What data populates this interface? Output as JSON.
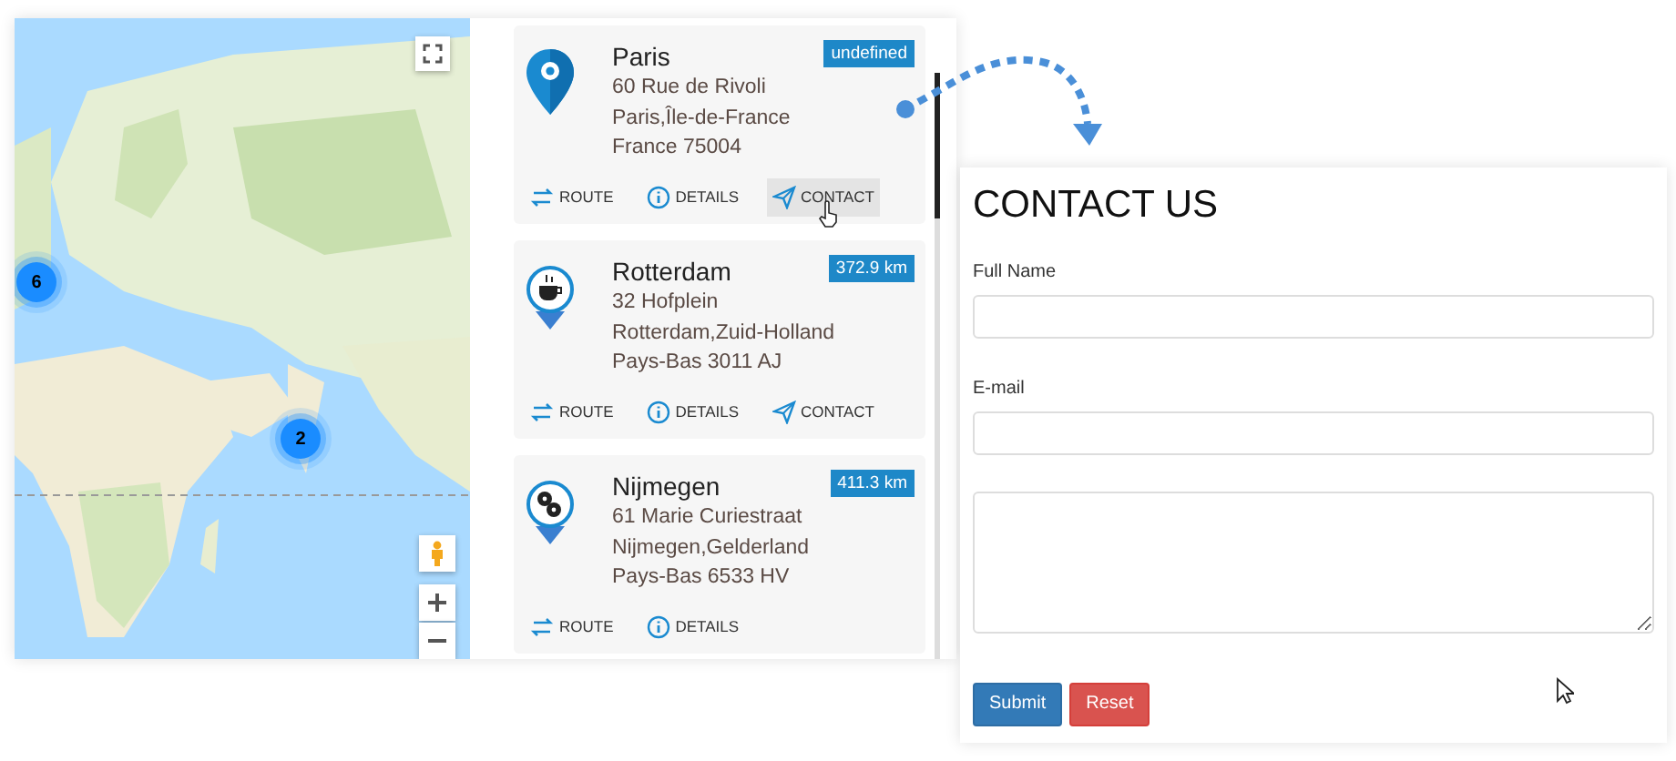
{
  "map": {
    "clusters": [
      {
        "count": "6"
      },
      {
        "count": "2"
      }
    ]
  },
  "locations": [
    {
      "name": "Paris",
      "badge": "undefined",
      "kind": "pin",
      "lines": [
        "60 Rue de Rivoli",
        "Paris,Île-de-France",
        "France 75004"
      ],
      "actions": [
        {
          "kind": "route",
          "label": "ROUTE",
          "hovered": false
        },
        {
          "kind": "details",
          "label": "DETAILS",
          "hovered": false
        },
        {
          "kind": "contact",
          "label": "CONTACT",
          "hovered": true
        }
      ]
    },
    {
      "name": "Rotterdam",
      "badge": "372.9 km",
      "kind": "coffee",
      "lines": [
        "32 Hofplein",
        "Rotterdam,Zuid-Holland",
        "Pays-Bas 3011 AJ"
      ],
      "actions": [
        {
          "kind": "route",
          "label": "ROUTE",
          "hovered": false
        },
        {
          "kind": "details",
          "label": "DETAILS",
          "hovered": false
        },
        {
          "kind": "contact",
          "label": "CONTACT",
          "hovered": false
        }
      ]
    },
    {
      "name": "Nijmegen",
      "badge": "411.3 km",
      "kind": "film",
      "lines": [
        "61 Marie Curiestraat",
        "Nijmegen,Gelderland",
        "Pays-Bas 6533 HV"
      ],
      "actions": [
        {
          "kind": "route",
          "label": "ROUTE",
          "hovered": false
        },
        {
          "kind": "details",
          "label": "DETAILS",
          "hovered": false
        }
      ]
    }
  ],
  "contact_form": {
    "title": "CONTACT US",
    "fields": [
      {
        "kind": "input",
        "label": "Full Name"
      },
      {
        "kind": "input",
        "label": "E-mail"
      },
      {
        "kind": "textarea"
      }
    ],
    "buttons": [
      {
        "kind": "primary",
        "label": "Submit"
      },
      {
        "kind": "danger",
        "label": "Reset"
      }
    ]
  }
}
